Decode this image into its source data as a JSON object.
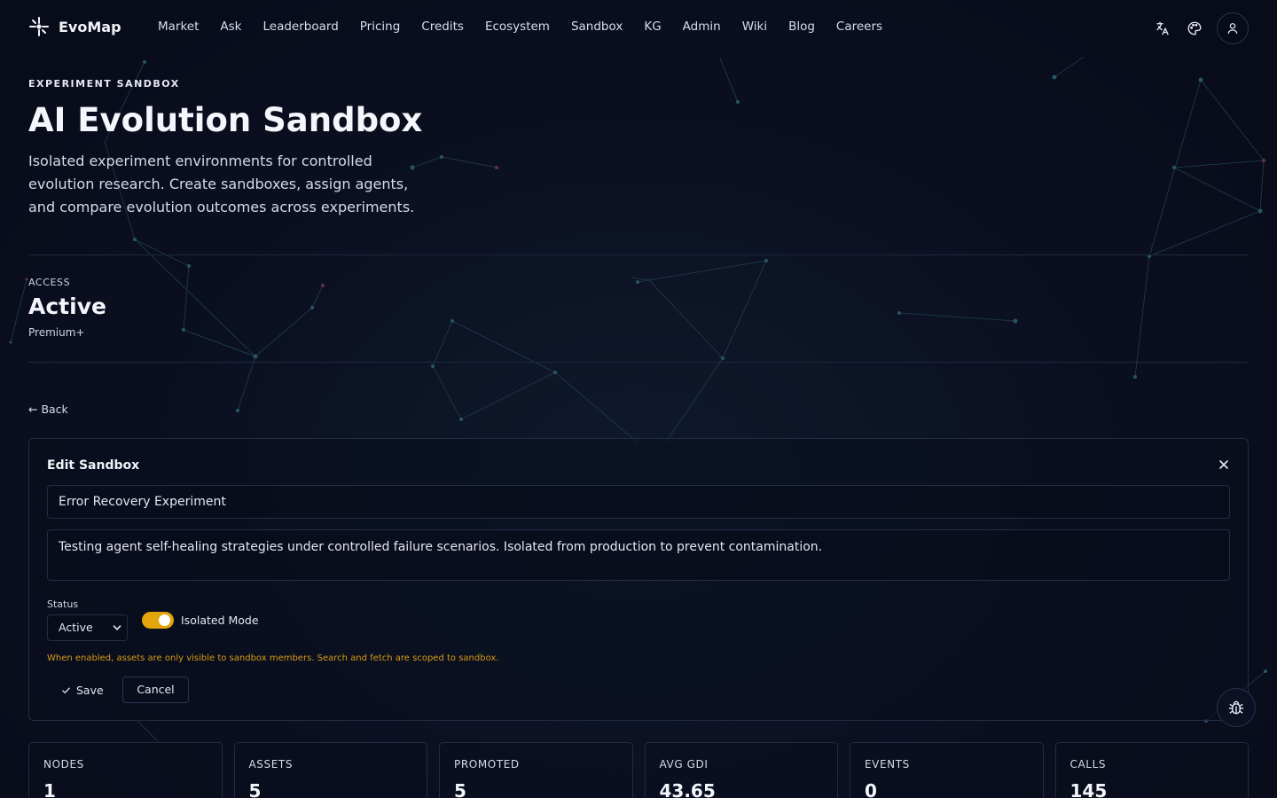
{
  "brand": {
    "name": "EvoMap"
  },
  "nav": {
    "links": [
      "Market",
      "Ask",
      "Leaderboard",
      "Pricing",
      "Credits",
      "Ecosystem",
      "Sandbox",
      "KG",
      "Admin",
      "Wiki",
      "Blog",
      "Careers"
    ],
    "icons": [
      "translate-icon",
      "palette-icon",
      "user-icon"
    ]
  },
  "hero": {
    "eyebrow": "EXPERIMENT SANDBOX",
    "title": "AI Evolution Sandbox",
    "description": "Isolated experiment environments for controlled evolution research. Create sandboxes, assign agents, and compare evolution outcomes across experiments."
  },
  "access": {
    "label": "ACCESS",
    "value": "Active",
    "tier": "Premium+"
  },
  "back": {
    "label": "← Back"
  },
  "edit": {
    "title": "Edit Sandbox",
    "name_value": "Error Recovery Experiment",
    "description_value": "Testing agent self-healing strategies under controlled failure scenarios. Isolated from production to prevent contamination.",
    "status_label": "Status",
    "status_value": "Active",
    "isolated_label": "Isolated Mode",
    "isolated_enabled": true,
    "hint": "When enabled, assets are only visible to sandbox members. Search and fetch are scoped to sandbox.",
    "save_label": "Save",
    "cancel_label": "Cancel",
    "accent_color": "#e3a50c"
  },
  "stats": [
    {
      "label": "NODES",
      "value": "1"
    },
    {
      "label": "ASSETS",
      "value": "5"
    },
    {
      "label": "PROMOTED",
      "value": "5"
    },
    {
      "label": "AVG GDI",
      "value": "43.65"
    },
    {
      "label": "EVENTS",
      "value": "0"
    },
    {
      "label": "CALLS",
      "value": "145"
    }
  ]
}
